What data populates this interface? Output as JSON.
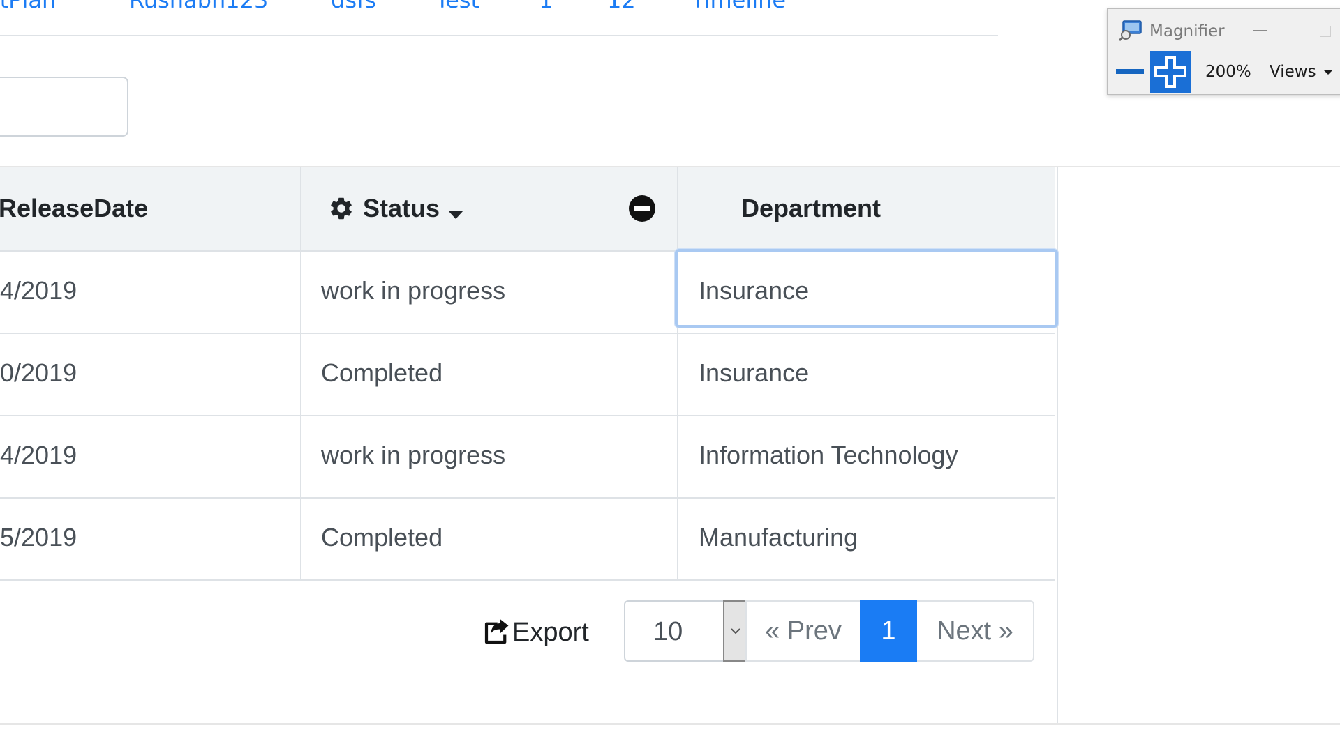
{
  "nav": {
    "tabs": [
      "ctPlan",
      "Rushabh123",
      "dsfs",
      "Test",
      "1",
      "12",
      "Timeline"
    ]
  },
  "search": {
    "value": ""
  },
  "grid": {
    "columns": [
      {
        "label": "ReleaseDate"
      },
      {
        "label": "Status",
        "has_gear_icon": true,
        "sorted": "descending",
        "has_remove_icon": true
      },
      {
        "label": "Department"
      }
    ],
    "rows": [
      {
        "release_date": "4/2019",
        "status": "work in progress",
        "department": "Insurance"
      },
      {
        "release_date": "0/2019",
        "status": "Completed",
        "department": "Insurance"
      },
      {
        "release_date": "4/2019",
        "status": "work in progress",
        "department": "Information Technology"
      },
      {
        "release_date": "5/2019",
        "status": "Completed",
        "department": "Manufacturing"
      }
    ],
    "focused_cell": {
      "row": 1,
      "column": "Department"
    }
  },
  "footer": {
    "export_label": "Export",
    "page_size": "10",
    "prev_label": "« Prev",
    "current_page": "1",
    "next_label": "Next »"
  },
  "magnifier": {
    "title": "Magnifier",
    "zoom_level": "200%",
    "views_label": "Views"
  },
  "colors": {
    "link": "#1c7cf4",
    "active_page": "#1a7cf4",
    "header_bg": "#f0f3f5",
    "focus_outline": "#a9c9f2",
    "magnifier_accent": "#1a6fd6"
  },
  "icons": [
    "gear-icon",
    "caret-down-icon",
    "minus-circle-icon",
    "share-icon",
    "chevron-down-icon",
    "magnifier-app-icon",
    "zoom-out-icon",
    "zoom-in-icon"
  ]
}
